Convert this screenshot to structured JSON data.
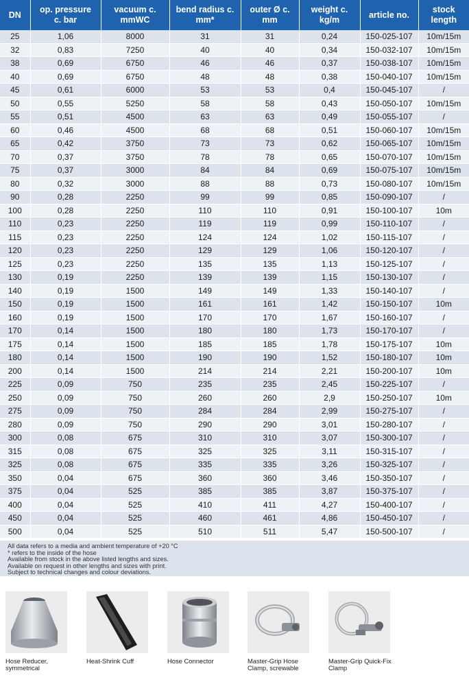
{
  "table": {
    "headers": [
      "DN",
      "op. pressure\nc. bar",
      "vacuum c.\nmmWC",
      "bend radius c.\nmm*",
      "outer Ø c.\nmm",
      "weight c.\nkg/m",
      "article no.",
      "stock\nlength"
    ],
    "rows": [
      [
        "25",
        "1,06",
        "8000",
        "31",
        "31",
        "0,24",
        "150-025-107",
        "10m/15m"
      ],
      [
        "32",
        "0,83",
        "7250",
        "40",
        "40",
        "0,34",
        "150-032-107",
        "10m/15m"
      ],
      [
        "38",
        "0,69",
        "6750",
        "46",
        "46",
        "0,37",
        "150-038-107",
        "10m/15m"
      ],
      [
        "40",
        "0,69",
        "6750",
        "48",
        "48",
        "0,38",
        "150-040-107",
        "10m/15m"
      ],
      [
        "45",
        "0,61",
        "6000",
        "53",
        "53",
        "0,4",
        "150-045-107",
        "/"
      ],
      [
        "50",
        "0,55",
        "5250",
        "58",
        "58",
        "0,43",
        "150-050-107",
        "10m/15m"
      ],
      [
        "55",
        "0,51",
        "4500",
        "63",
        "63",
        "0,49",
        "150-055-107",
        "/"
      ],
      [
        "60",
        "0,46",
        "4500",
        "68",
        "68",
        "0,51",
        "150-060-107",
        "10m/15m"
      ],
      [
        "65",
        "0,42",
        "3750",
        "73",
        "73",
        "0,62",
        "150-065-107",
        "10m/15m"
      ],
      [
        "70",
        "0,37",
        "3750",
        "78",
        "78",
        "0,65",
        "150-070-107",
        "10m/15m"
      ],
      [
        "75",
        "0,37",
        "3000",
        "84",
        "84",
        "0,69",
        "150-075-107",
        "10m/15m"
      ],
      [
        "80",
        "0,32",
        "3000",
        "88",
        "88",
        "0,73",
        "150-080-107",
        "10m/15m"
      ],
      [
        "90",
        "0,28",
        "2250",
        "99",
        "99",
        "0,85",
        "150-090-107",
        "/"
      ],
      [
        "100",
        "0,28",
        "2250",
        "110",
        "110",
        "0,91",
        "150-100-107",
        "10m"
      ],
      [
        "110",
        "0,23",
        "2250",
        "119",
        "119",
        "0,99",
        "150-110-107",
        "/"
      ],
      [
        "115",
        "0,23",
        "2250",
        "124",
        "124",
        "1,02",
        "150-115-107",
        "/"
      ],
      [
        "120",
        "0,23",
        "2250",
        "129",
        "129",
        "1,06",
        "150-120-107",
        "/"
      ],
      [
        "125",
        "0,23",
        "2250",
        "135",
        "135",
        "1,13",
        "150-125-107",
        "/"
      ],
      [
        "130",
        "0,19",
        "2250",
        "139",
        "139",
        "1,15",
        "150-130-107",
        "/"
      ],
      [
        "140",
        "0,19",
        "1500",
        "149",
        "149",
        "1,33",
        "150-140-107",
        "/"
      ],
      [
        "150",
        "0,19",
        "1500",
        "161",
        "161",
        "1,42",
        "150-150-107",
        "10m"
      ],
      [
        "160",
        "0,19",
        "1500",
        "170",
        "170",
        "1,67",
        "150-160-107",
        "/"
      ],
      [
        "170",
        "0,14",
        "1500",
        "180",
        "180",
        "1,73",
        "150-170-107",
        "/"
      ],
      [
        "175",
        "0,14",
        "1500",
        "185",
        "185",
        "1,78",
        "150-175-107",
        "10m"
      ],
      [
        "180",
        "0,14",
        "1500",
        "190",
        "190",
        "1,52",
        "150-180-107",
        "10m"
      ],
      [
        "200",
        "0,14",
        "1500",
        "214",
        "214",
        "2,21",
        "150-200-107",
        "10m"
      ],
      [
        "225",
        "0,09",
        "750",
        "235",
        "235",
        "2,45",
        "150-225-107",
        "/"
      ],
      [
        "250",
        "0,09",
        "750",
        "260",
        "260",
        "2,9",
        "150-250-107",
        "10m"
      ],
      [
        "275",
        "0,09",
        "750",
        "284",
        "284",
        "2,99",
        "150-275-107",
        "/"
      ],
      [
        "280",
        "0,09",
        "750",
        "290",
        "290",
        "3,01",
        "150-280-107",
        "/"
      ],
      [
        "300",
        "0,08",
        "675",
        "310",
        "310",
        "3,07",
        "150-300-107",
        "/"
      ],
      [
        "315",
        "0,08",
        "675",
        "325",
        "325",
        "3,11",
        "150-315-107",
        "/"
      ],
      [
        "325",
        "0,08",
        "675",
        "335",
        "335",
        "3,26",
        "150-325-107",
        "/"
      ],
      [
        "350",
        "0,04",
        "675",
        "360",
        "360",
        "3,46",
        "150-350-107",
        "/"
      ],
      [
        "375",
        "0,04",
        "525",
        "385",
        "385",
        "3,87",
        "150-375-107",
        "/"
      ],
      [
        "400",
        "0,04",
        "525",
        "410",
        "411",
        "4,27",
        "150-400-107",
        "/"
      ],
      [
        "450",
        "0,04",
        "525",
        "460",
        "461",
        "4,86",
        "150-450-107",
        "/"
      ],
      [
        "500",
        "0,04",
        "525",
        "510",
        "511",
        "5,47",
        "150-500-107",
        "/"
      ]
    ]
  },
  "notes": [
    "All data refers to a media and ambient temperature of +20 °C",
    "* refers to the inside of the hose",
    "Available from stock in the above listed lengths and sizes.",
    "Available on request in other lengths and sizes with print.",
    "Subject to technical changes and colour deviations."
  ],
  "accessories": [
    {
      "name": "Hose Reducer,\nsymmetrical",
      "icon": "hose-reducer-photo"
    },
    {
      "name": "Heat-Shrink Cuff",
      "icon": "heat-shrink-cuff-photo"
    },
    {
      "name": "Hose Connector",
      "icon": "hose-connector-photo"
    },
    {
      "name": "Master-Grip Hose\nClamp, screwable",
      "icon": "hose-clamp-photo"
    },
    {
      "name": "Master-Grip Quick-Fix\nClamp",
      "icon": "quick-fix-clamp-photo"
    }
  ],
  "colors": {
    "header_bg": "#1f62ad",
    "row_odd": "#dde3ec",
    "row_even": "#eef1f5"
  }
}
